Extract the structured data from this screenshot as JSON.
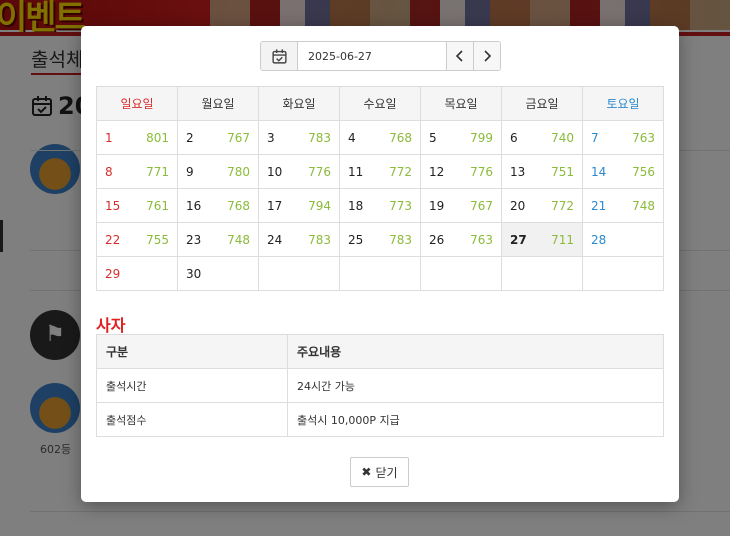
{
  "background": {
    "banner_text": "이벤트",
    "page_title": "출석체",
    "date_prefix": "20",
    "rank_text": "602등"
  },
  "date_picker": {
    "value": "2025-06-27",
    "prev_icon": "chevron-left-icon",
    "next_icon": "chevron-right-icon",
    "calendar_icon": "calendar-check-icon"
  },
  "calendar": {
    "weekdays": [
      "일요일",
      "월요일",
      "화요일",
      "수요일",
      "목요일",
      "금요일",
      "토요일"
    ],
    "weeks": [
      [
        {
          "day": "1",
          "count": "801"
        },
        {
          "day": "2",
          "count": "767"
        },
        {
          "day": "3",
          "count": "783"
        },
        {
          "day": "4",
          "count": "768"
        },
        {
          "day": "5",
          "count": "799"
        },
        {
          "day": "6",
          "count": "740"
        },
        {
          "day": "7",
          "count": "763"
        }
      ],
      [
        {
          "day": "8",
          "count": "771"
        },
        {
          "day": "9",
          "count": "780"
        },
        {
          "day": "10",
          "count": "776"
        },
        {
          "day": "11",
          "count": "772"
        },
        {
          "day": "12",
          "count": "776"
        },
        {
          "day": "13",
          "count": "751"
        },
        {
          "day": "14",
          "count": "756"
        }
      ],
      [
        {
          "day": "15",
          "count": "761"
        },
        {
          "day": "16",
          "count": "768"
        },
        {
          "day": "17",
          "count": "794"
        },
        {
          "day": "18",
          "count": "773"
        },
        {
          "day": "19",
          "count": "767"
        },
        {
          "day": "20",
          "count": "772"
        },
        {
          "day": "21",
          "count": "748"
        }
      ],
      [
        {
          "day": "22",
          "count": "755"
        },
        {
          "day": "23",
          "count": "748"
        },
        {
          "day": "24",
          "count": "783"
        },
        {
          "day": "25",
          "count": "783"
        },
        {
          "day": "26",
          "count": "763"
        },
        {
          "day": "27",
          "count": "711"
        },
        {
          "day": "28",
          "count": ""
        }
      ],
      [
        {
          "day": "29",
          "count": ""
        },
        {
          "day": "30",
          "count": ""
        },
        {
          "day": "",
          "count": ""
        },
        {
          "day": "",
          "count": ""
        },
        {
          "day": "",
          "count": ""
        },
        {
          "day": "",
          "count": ""
        },
        {
          "day": "",
          "count": ""
        }
      ]
    ],
    "today": "27"
  },
  "info": {
    "title": "사자",
    "headers": [
      "구분",
      "주요내용"
    ],
    "rows": [
      [
        "출석시간",
        "24시간 가능"
      ],
      [
        "출석점수",
        "출석시 10,000P 지급"
      ]
    ]
  },
  "close_button": {
    "label": "닫기",
    "icon": "close-icon"
  },
  "colors": {
    "sunday": "#d92b2b",
    "saturday": "#2a8ad0",
    "count": "#8bbb3a",
    "title": "#e02020"
  }
}
